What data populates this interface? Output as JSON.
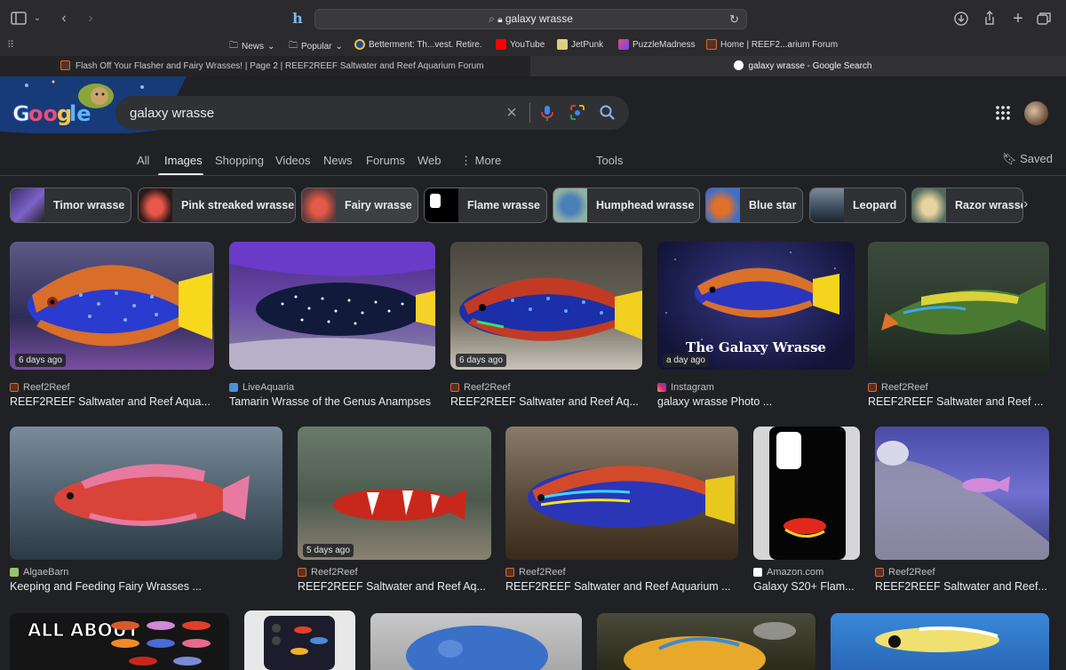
{
  "browser": {
    "address": "galaxy wrasse",
    "favorites": [
      {
        "label": "News",
        "dropdown": true
      },
      {
        "label": "Popular",
        "dropdown": true
      },
      {
        "label": "Betterment: Th...vest. Retire."
      },
      {
        "label": "YouTube"
      },
      {
        "label": "JetPunk"
      },
      {
        "label": "PuzzleMadness"
      },
      {
        "label": "Home | REEF2...arium Forum"
      }
    ],
    "tabs": [
      {
        "title": "Flash Off Your Flasher and Fairy Wrasses! | Page 2 | REEF2REEF Saltwater and Reef Aquarium Forum",
        "active": false
      },
      {
        "title": "galaxy wrasse - Google Search",
        "active": true
      }
    ]
  },
  "search": {
    "query": "galaxy wrasse"
  },
  "nav": {
    "items": [
      "All",
      "Images",
      "Shopping",
      "Videos",
      "News",
      "Forums",
      "Web",
      "More"
    ],
    "active": "Images",
    "tools": "Tools",
    "saved": "Saved"
  },
  "chips": [
    {
      "label": "Timor wrasse"
    },
    {
      "label": "Pink streaked wrasse"
    },
    {
      "label": "Fairy wrasse",
      "selected": true
    },
    {
      "label": "Flame wrasse"
    },
    {
      "label": "Humphead wrasse"
    },
    {
      "label": "Blue star"
    },
    {
      "label": "Leopard"
    },
    {
      "label": "Razor wrasse"
    }
  ],
  "results": [
    {
      "source": "Reef2Reef",
      "title": "REEF2REEF Saltwater and Reef Aqua...",
      "age": "6 days ago"
    },
    {
      "source": "LiveAquaria",
      "title": "Tamarin Wrasse of the Genus Anampses",
      "age": ""
    },
    {
      "source": "Reef2Reef",
      "title": "REEF2REEF Saltwater and Reef Aq...",
      "age": "6 days ago"
    },
    {
      "source": "Instagram",
      "title": "galaxy wrasse Photo ...",
      "age": "a day ago",
      "overlay": "The Galaxy Wrasse"
    },
    {
      "source": "Reef2Reef",
      "title": "REEF2REEF Saltwater and Reef ...",
      "age": ""
    },
    {
      "source": "AlgaeBarn",
      "title": "Keeping and Feeding Fairy Wrasses ...",
      "age": ""
    },
    {
      "source": "Reef2Reef",
      "title": "REEF2REEF Saltwater and Reef Aq...",
      "age": "5 days ago"
    },
    {
      "source": "Reef2Reef",
      "title": "REEF2REEF Saltwater and Reef Aquarium ...",
      "age": ""
    },
    {
      "source": "Amazon.com",
      "title": "Galaxy S20+ Flam...",
      "age": ""
    },
    {
      "source": "Reef2Reef",
      "title": "REEF2REEF Saltwater and Reef...",
      "age": ""
    },
    {
      "overlay": "ALL ABOUT"
    }
  ],
  "colors": {
    "page_bg": "#202124",
    "search_box": "#303134",
    "chrome_bg": "#2b2b2d"
  }
}
